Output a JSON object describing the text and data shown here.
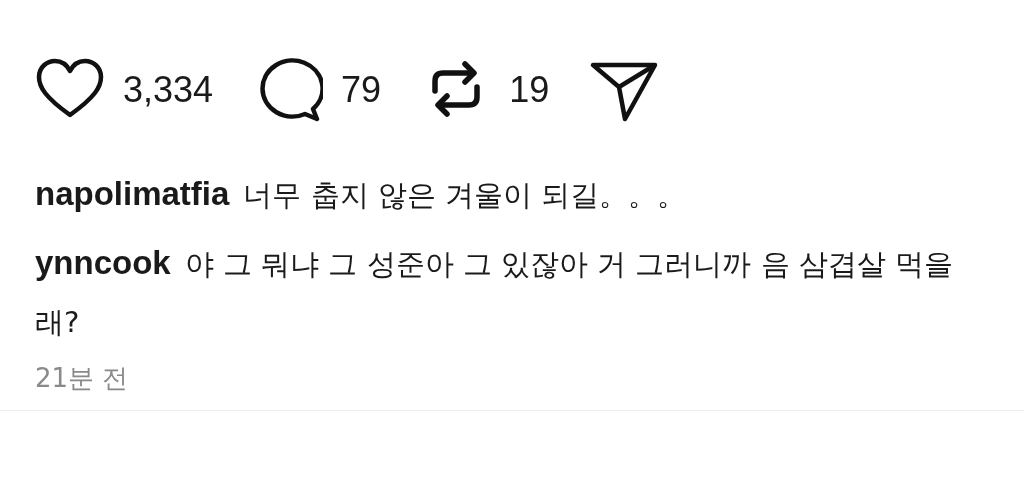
{
  "actions": [
    {
      "kind": "like",
      "count": "3,334"
    },
    {
      "kind": "comment",
      "count": "79"
    },
    {
      "kind": "repost",
      "count": "19"
    },
    {
      "kind": "share"
    }
  ],
  "comments": [
    {
      "username": "napolimatfia",
      "text": "너무 춥지 않은 겨울이 되길。。。"
    },
    {
      "username": "ynncook",
      "text": "야 그 뭐냐 그 성준아 그 있잖아 거 그러니까 음 삼겹살 먹을래?"
    }
  ],
  "timestamp": "21분 전"
}
